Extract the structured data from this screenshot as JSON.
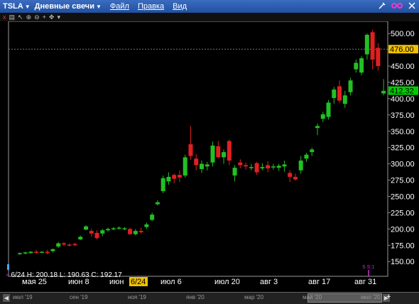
{
  "window": {
    "symbol": "TSLA",
    "chart_type": "Дневные свечи",
    "menus": [
      "Файл",
      "Правка",
      "Вид"
    ]
  },
  "toolbar": {
    "close": "x",
    "icons": [
      "table-icon",
      "cursor-icon",
      "zoom-in-icon",
      "zoom-out-icon",
      "crosshair-icon",
      "pan-icon",
      "compare-icon"
    ]
  },
  "info": {
    "date": "6/24",
    "high": "H: 200.18",
    "low": "L: 190.63",
    "close": "C: 192.17"
  },
  "price_tags": {
    "crosshair": "476.00",
    "last": "412.32"
  },
  "x_labels": [
    "мая 25",
    "июн 8",
    "июн",
    "6/24",
    "июл 6",
    "июл 20",
    "авг 3",
    "авг 17",
    "авг 31"
  ],
  "nav_labels": [
    "июл '19",
    "сен '19",
    "ноя '19",
    "янв '20",
    "мар '20",
    "май '20",
    "июл '20"
  ],
  "event_marker": "S S:1",
  "colors": {
    "up": "#22c022",
    "down": "#e02020",
    "accent": "#f0c000",
    "title": "#2f62b8"
  },
  "chart_data": {
    "type": "candlestick",
    "ylim": [
      135,
      510
    ],
    "yticks": [
      150,
      175,
      200,
      225,
      250,
      275,
      300,
      325,
      350,
      375,
      400,
      425,
      450,
      475,
      500
    ],
    "crosshair_price": 476.0,
    "last_price": 412.32,
    "candles": [
      {
        "o": 162,
        "h": 164,
        "l": 160,
        "c": 163
      },
      {
        "o": 163,
        "h": 165,
        "l": 161,
        "c": 164
      },
      {
        "o": 163,
        "h": 166,
        "l": 162,
        "c": 165
      },
      {
        "o": 165,
        "h": 168,
        "l": 162,
        "c": 164
      },
      {
        "o": 164,
        "h": 166,
        "l": 163,
        "c": 165
      },
      {
        "o": 165,
        "h": 168,
        "l": 161,
        "c": 163
      },
      {
        "o": 166,
        "h": 170,
        "l": 164,
        "c": 169
      },
      {
        "o": 173,
        "h": 180,
        "l": 171,
        "c": 178
      },
      {
        "o": 178,
        "h": 180,
        "l": 174,
        "c": 176
      },
      {
        "o": 176,
        "h": 178,
        "l": 173,
        "c": 175
      },
      {
        "o": 177,
        "h": 179,
        "l": 174,
        "c": 175
      },
      {
        "o": 184,
        "h": 190,
        "l": 183,
        "c": 188
      },
      {
        "o": 199,
        "h": 206,
        "l": 198,
        "c": 204
      },
      {
        "o": 197,
        "h": 200,
        "l": 188,
        "c": 193
      },
      {
        "o": 194,
        "h": 198,
        "l": 184,
        "c": 186
      },
      {
        "o": 193,
        "h": 200,
        "l": 189,
        "c": 198
      },
      {
        "o": 198,
        "h": 202,
        "l": 196,
        "c": 200
      },
      {
        "o": 200,
        "h": 203,
        "l": 198,
        "c": 201
      },
      {
        "o": 201,
        "h": 204,
        "l": 199,
        "c": 202
      },
      {
        "o": 200,
        "h": 203,
        "l": 198,
        "c": 201
      },
      {
        "o": 200,
        "h": 202,
        "l": 191,
        "c": 192
      },
      {
        "o": 192,
        "h": 200,
        "l": 190,
        "c": 197
      },
      {
        "o": 197,
        "h": 202,
        "l": 193,
        "c": 195
      },
      {
        "o": 203,
        "h": 210,
        "l": 200,
        "c": 207
      },
      {
        "o": 214,
        "h": 225,
        "l": 212,
        "c": 222
      },
      {
        "o": 238,
        "h": 244,
        "l": 236,
        "c": 241
      },
      {
        "o": 258,
        "h": 282,
        "l": 255,
        "c": 278
      },
      {
        "o": 273,
        "h": 287,
        "l": 268,
        "c": 280
      },
      {
        "o": 283,
        "h": 285,
        "l": 270,
        "c": 277
      },
      {
        "o": 283,
        "h": 290,
        "l": 272,
        "c": 279
      },
      {
        "o": 282,
        "h": 314,
        "l": 279,
        "c": 310
      },
      {
        "o": 330,
        "h": 358,
        "l": 306,
        "c": 312
      },
      {
        "o": 308,
        "h": 315,
        "l": 290,
        "c": 298
      },
      {
        "o": 292,
        "h": 305,
        "l": 286,
        "c": 300
      },
      {
        "o": 296,
        "h": 303,
        "l": 290,
        "c": 299
      },
      {
        "o": 302,
        "h": 334,
        "l": 296,
        "c": 328
      },
      {
        "o": 327,
        "h": 335,
        "l": 308,
        "c": 310
      },
      {
        "o": 310,
        "h": 322,
        "l": 300,
        "c": 318
      },
      {
        "o": 335,
        "h": 337,
        "l": 298,
        "c": 305
      },
      {
        "o": 282,
        "h": 298,
        "l": 273,
        "c": 294
      },
      {
        "o": 302,
        "h": 307,
        "l": 293,
        "c": 298
      },
      {
        "o": 298,
        "h": 302,
        "l": 291,
        "c": 296
      },
      {
        "o": 295,
        "h": 300,
        "l": 290,
        "c": 295
      },
      {
        "o": 301,
        "h": 303,
        "l": 283,
        "c": 287
      },
      {
        "o": 293,
        "h": 301,
        "l": 290,
        "c": 295
      },
      {
        "o": 298,
        "h": 304,
        "l": 287,
        "c": 293
      },
      {
        "o": 295,
        "h": 300,
        "l": 291,
        "c": 296
      },
      {
        "o": 294,
        "h": 300,
        "l": 289,
        "c": 297
      },
      {
        "o": 296,
        "h": 305,
        "l": 288,
        "c": 299
      },
      {
        "o": 286,
        "h": 290,
        "l": 272,
        "c": 280
      },
      {
        "o": 280,
        "h": 285,
        "l": 274,
        "c": 276
      },
      {
        "o": 290,
        "h": 312,
        "l": 285,
        "c": 305
      },
      {
        "o": 308,
        "h": 317,
        "l": 303,
        "c": 314
      },
      {
        "o": 318,
        "h": 325,
        "l": 312,
        "c": 322
      },
      {
        "o": 355,
        "h": 362,
        "l": 344,
        "c": 358
      },
      {
        "o": 369,
        "h": 380,
        "l": 364,
        "c": 376
      },
      {
        "o": 372,
        "h": 398,
        "l": 368,
        "c": 394
      },
      {
        "o": 401,
        "h": 418,
        "l": 392,
        "c": 414
      },
      {
        "o": 419,
        "h": 428,
        "l": 393,
        "c": 397
      },
      {
        "o": 392,
        "h": 412,
        "l": 386,
        "c": 405
      },
      {
        "o": 410,
        "h": 432,
        "l": 405,
        "c": 428
      },
      {
        "o": 445,
        "h": 460,
        "l": 440,
        "c": 455
      },
      {
        "o": 440,
        "h": 465,
        "l": 436,
        "c": 462
      },
      {
        "o": 468,
        "h": 500,
        "l": 460,
        "c": 498
      },
      {
        "o": 502,
        "h": 506,
        "l": 445,
        "c": 460
      },
      {
        "o": 478,
        "h": 485,
        "l": 443,
        "c": 450
      },
      {
        "o": 408,
        "h": 430,
        "l": 405,
        "c": 412
      }
    ]
  }
}
